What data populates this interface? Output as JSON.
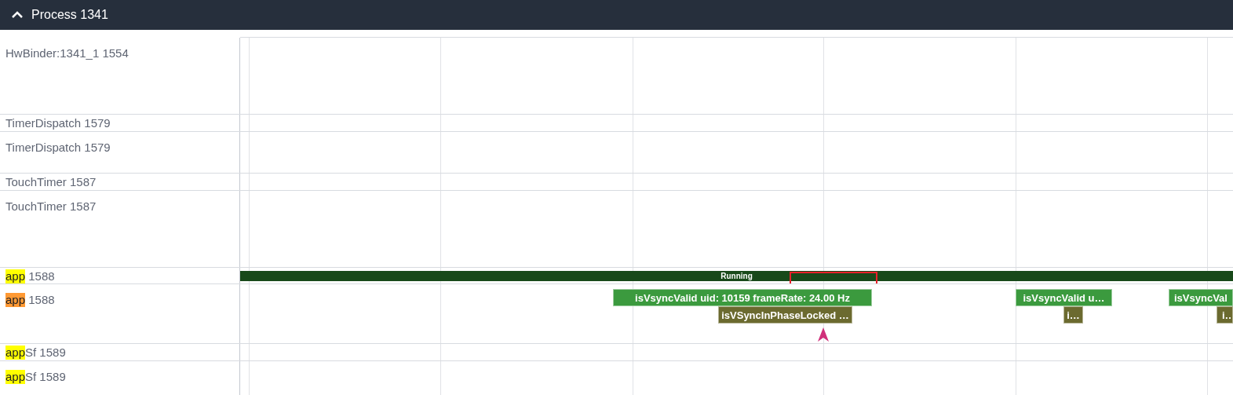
{
  "group": {
    "title": "Process 1341",
    "expanded": true
  },
  "rows": [
    {
      "kind": "slices",
      "name": "HwBinder:1341_1 1554"
    },
    {
      "kind": "state",
      "name": "TimerDispatch 1579"
    },
    {
      "kind": "slices",
      "name": "TimerDispatch 1579"
    },
    {
      "kind": "state",
      "name": "TouchTimer 1587"
    },
    {
      "kind": "slices",
      "name": "TouchTimer 1587"
    },
    {
      "kind": "state",
      "match": "app",
      "name": " 1588",
      "color": "#ffff00",
      "state_bar": {
        "label": "Running"
      }
    },
    {
      "kind": "slices",
      "match": "app",
      "name": " 1588",
      "color": "#ff9933",
      "slices": [
        {
          "label": "isVsyncValid uid: 10159 frameRate: 24.00 Hz",
          "children": [
            {
              "label": "isVSyncInPhaseLocked …"
            }
          ]
        },
        {
          "label": "isVsyncValid u…",
          "children": [
            {
              "label": "i…"
            }
          ]
        },
        {
          "label": "isVsyncVal",
          "children": [
            {
              "label": "i…"
            }
          ]
        }
      ]
    },
    {
      "kind": "state",
      "match": "app",
      "name": "Sf 1589",
      "color": "#ffff00"
    },
    {
      "kind": "slices",
      "match": "app",
      "name": "Sf 1589",
      "color": "#ffff00"
    }
  ]
}
